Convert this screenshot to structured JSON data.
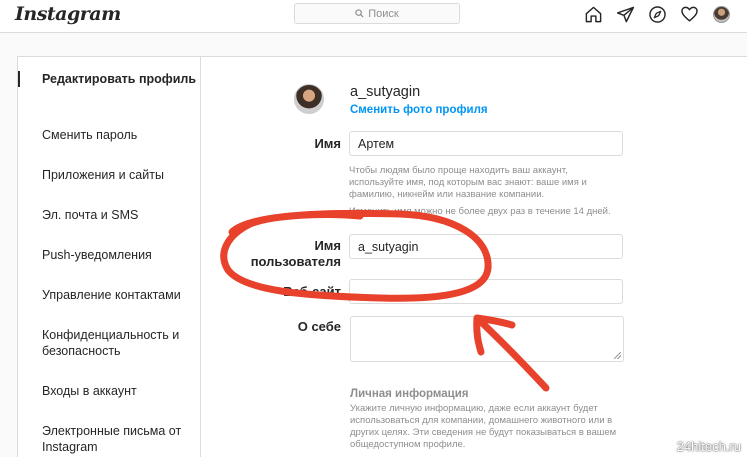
{
  "topnav": {
    "logo": "Instagram",
    "search_placeholder": "Поиск",
    "icons": [
      "home-icon",
      "direct-icon",
      "explore-icon",
      "activity-icon",
      "profile-avatar"
    ]
  },
  "sidebar": {
    "items": [
      {
        "label": "Редактировать профиль",
        "active": true
      },
      {
        "label": "Сменить пароль"
      },
      {
        "label": "Приложения и сайты"
      },
      {
        "label": "Эл. почта и SMS"
      },
      {
        "label": "Push-уведомления"
      },
      {
        "label": "Управление контактами"
      },
      {
        "label": "Конфиденциальность и безопасность"
      },
      {
        "label": "Входы в аккаунт"
      },
      {
        "label": "Электронные письма от Instagram"
      }
    ]
  },
  "profile": {
    "username": "a_sutyagin",
    "change_photo": "Сменить фото профиля"
  },
  "form": {
    "name_label": "Имя",
    "name_value": "Артем",
    "name_hint": "Чтобы людям было проще находить ваш аккаунт, используйте имя, под которым вас знают: ваше имя и фамилию, никнейм или название компании.",
    "name_hint2": "Изменить имя можно не более двух раз в течение 14 дней.",
    "username_label": "Имя пользователя",
    "username_value": "a_sutyagin",
    "website_label": "Веб-сайт",
    "website_value": "",
    "bio_label": "О себе",
    "bio_value": "",
    "personal_info_title": "Личная информация",
    "personal_info_hint": "Укажите личную информацию, даже если аккаунт будет использоваться для компании, домашнего животного или в других целях. Эти сведения не будут показываться в вашем общедоступном профиле."
  },
  "annotation": {
    "color": "#e8412c"
  },
  "watermark": "24hitech.ru"
}
